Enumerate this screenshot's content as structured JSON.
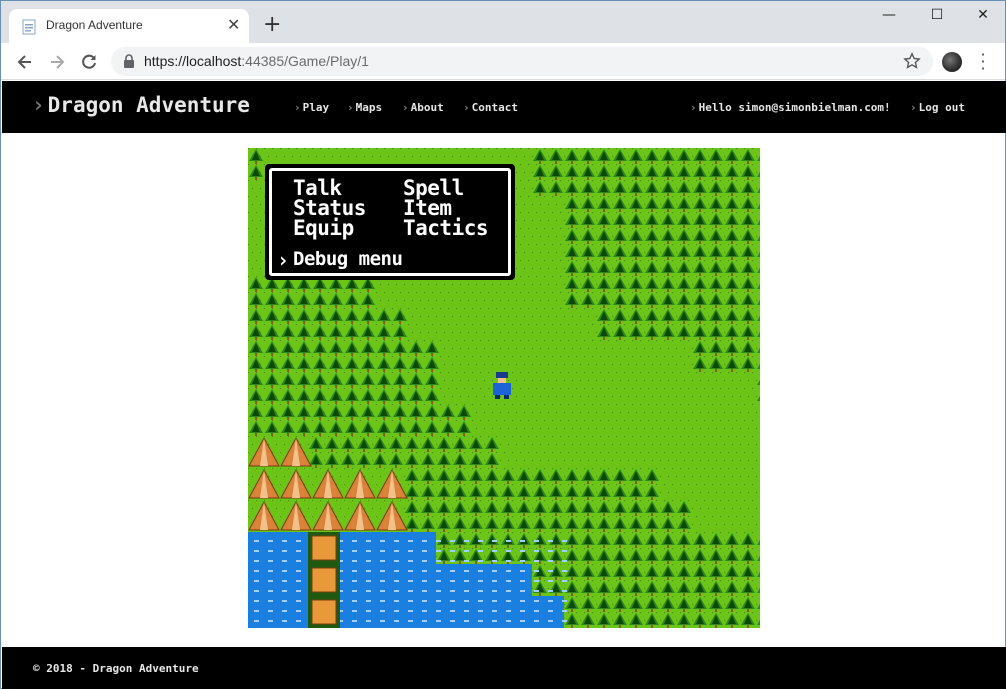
{
  "browser": {
    "tab_title": "Dragon Adventure",
    "tab_close": "✕",
    "new_tab": "+",
    "url_host": "https://localhost",
    "url_path": ":44385/Game/Play/1",
    "window_controls": {
      "minimize": "—",
      "maximize": "☐",
      "close": "✕"
    }
  },
  "header": {
    "brand": "Dragon Adventure",
    "nav": [
      "Play",
      "Maps",
      "About",
      "Contact"
    ],
    "user_greeting": "Hello simon@simonbielman.com!",
    "logout": "Log out"
  },
  "game": {
    "command_menu": {
      "col1": [
        "Talk",
        "Status",
        "Equip"
      ],
      "col2": [
        "Spell",
        "Item",
        "Tactics"
      ],
      "selected": "Debug menu",
      "cursor": "›"
    },
    "colors": {
      "grass": "#6cc418",
      "forest_dark": "#0c4a08",
      "forest_light": "#2a8a1e",
      "water": "#1b7fe0",
      "mountain": "#d8823a",
      "bridge": "#e89a3a"
    }
  },
  "footer": {
    "copyright": "© 2018 - Dragon Adventure"
  }
}
